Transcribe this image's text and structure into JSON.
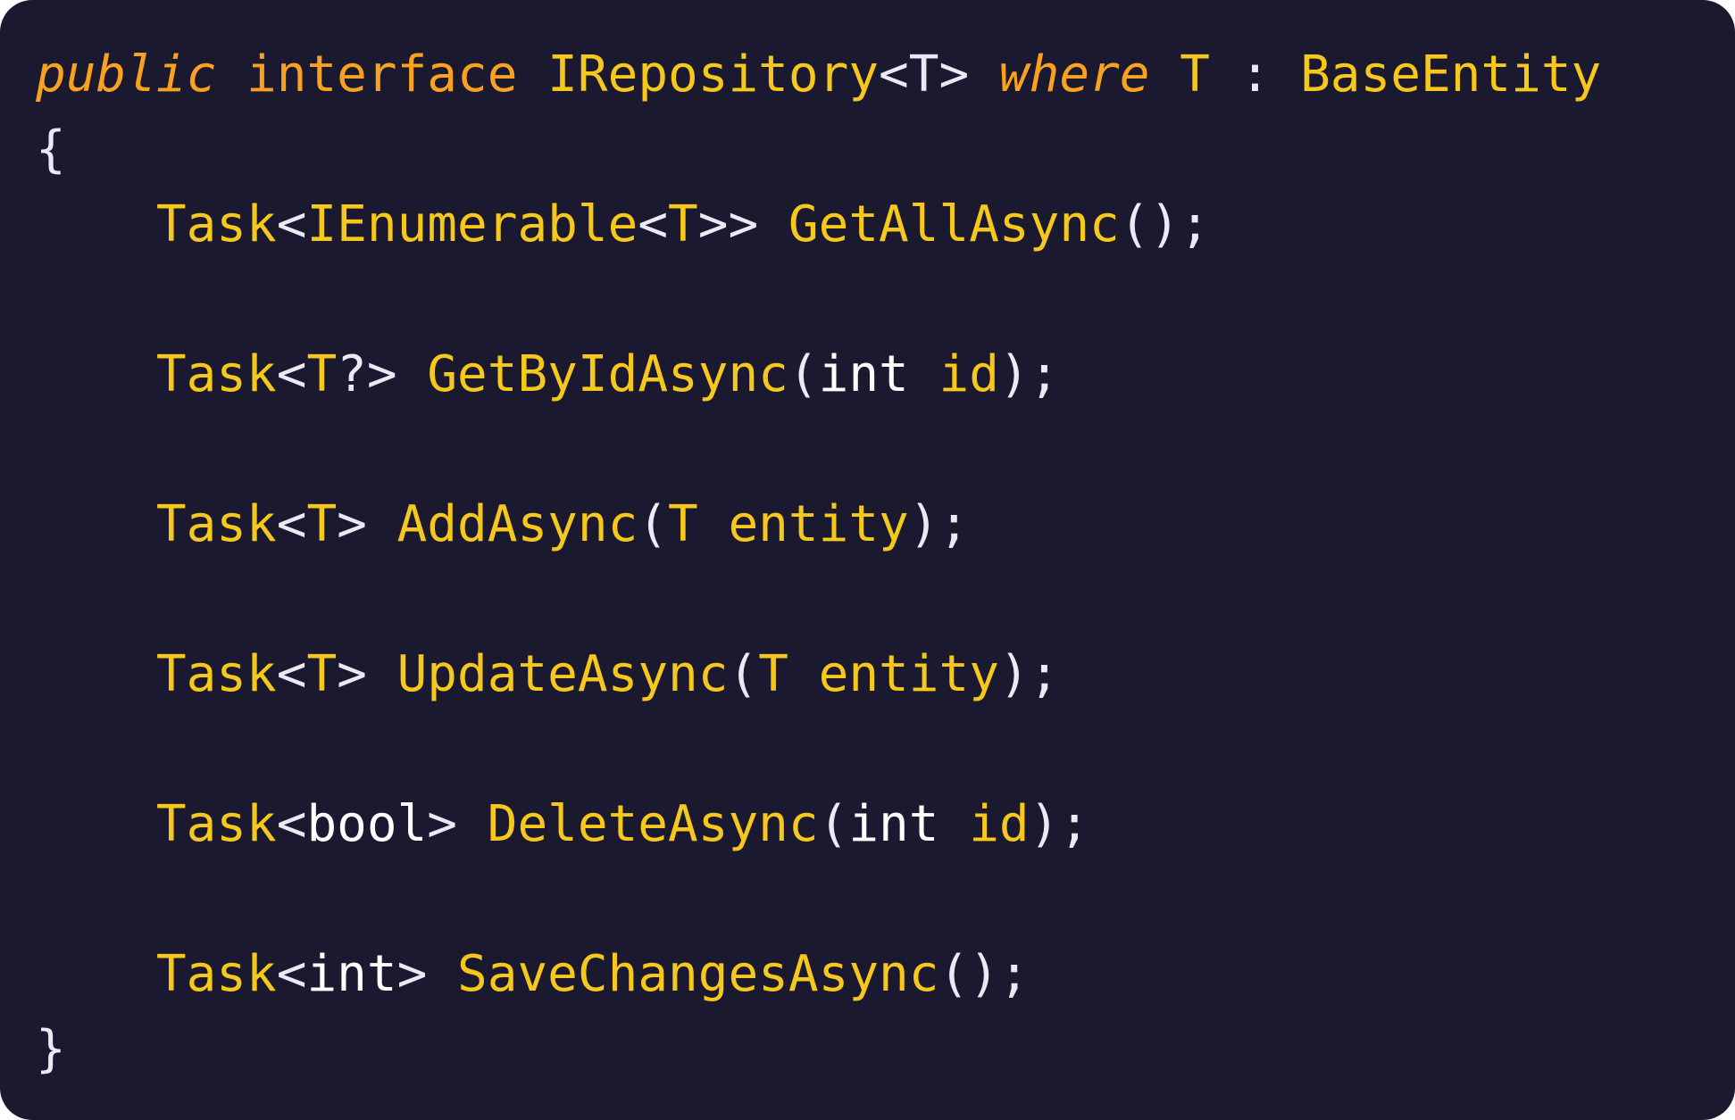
{
  "colors": {
    "background": "#1b1930",
    "keyword": "#f9a21e",
    "type": "#f6c81b",
    "punctuation": "#ece8f4",
    "builtin": "#ffffff"
  },
  "code": {
    "l1": {
      "public": "public",
      "sp1": " ",
      "interface": "interface",
      "sp2": " ",
      "name": "IRepository",
      "lt": "<",
      "T": "T",
      "gt": ">",
      "sp3": " ",
      "where": "where",
      "sp4": " ",
      "T2": "T",
      "colon": " : ",
      "base": "BaseEntity"
    },
    "l2": {
      "brace": "{"
    },
    "l3": {
      "indent": "    ",
      "task": "Task",
      "lt": "<",
      "ienum": "IEnumerable",
      "lt2": "<",
      "T": "T",
      "gt": ">>",
      "sp": " ",
      "method": "GetAllAsync",
      "params": "();"
    },
    "l5": {
      "indent": "    ",
      "task": "Task",
      "lt": "<",
      "T": "T",
      "q": "?>",
      "sp": " ",
      "method": "GetByIdAsync",
      "open": "(",
      "int": "int",
      "sp2": " ",
      "id": "id",
      "close": ");"
    },
    "l7": {
      "indent": "    ",
      "task": "Task",
      "lt": "<",
      "T": "T",
      "gt": ">",
      "sp": " ",
      "method": "AddAsync",
      "open": "(",
      "T2": "T",
      "sp2": " ",
      "entity": "entity",
      "close": ");"
    },
    "l9": {
      "indent": "    ",
      "task": "Task",
      "lt": "<",
      "T": "T",
      "gt": ">",
      "sp": " ",
      "method": "UpdateAsync",
      "open": "(",
      "T2": "T",
      "sp2": " ",
      "entity": "entity",
      "close": ");"
    },
    "l11": {
      "indent": "    ",
      "task": "Task",
      "lt": "<",
      "bool": "bool",
      "gt": ">",
      "sp": " ",
      "method": "DeleteAsync",
      "open": "(",
      "int": "int",
      "sp2": " ",
      "id": "id",
      "close": ");"
    },
    "l13": {
      "indent": "    ",
      "task": "Task",
      "lt": "<",
      "int": "int",
      "gt": ">",
      "sp": " ",
      "method": "SaveChangesAsync",
      "params": "();"
    },
    "l14": {
      "brace": "}"
    }
  }
}
